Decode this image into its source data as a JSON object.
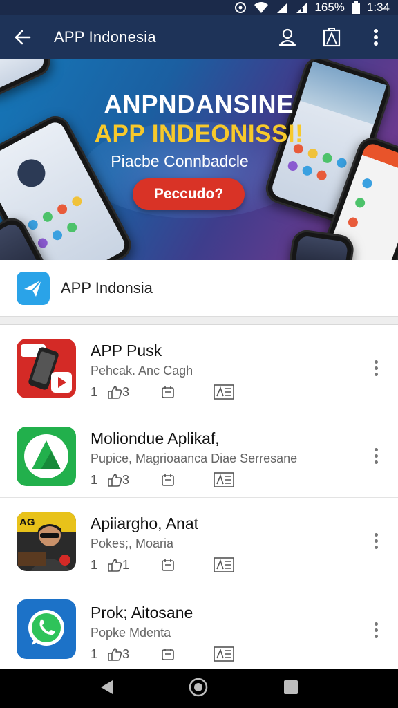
{
  "status_bar": {
    "battery": "165%",
    "time": "1:34"
  },
  "app_bar": {
    "title": "APP Indonesia"
  },
  "banner": {
    "heading_line1": "ANPNDANSINE",
    "heading_line2": "APP INDEONISSI!",
    "subheading": "Piacbe Connbadcle",
    "button_label": "Peccudo?"
  },
  "section": {
    "title": "APP Indonsia"
  },
  "apps": [
    {
      "name": "APP Pusk",
      "subtitle": "Pehcak. Anc Cagh",
      "count": "1",
      "likes": "3",
      "icon": "red-phone-icon"
    },
    {
      "name": "Moliondue Aplikaf,",
      "subtitle": "Pupice, Magrioaanca Diae Serresane",
      "count": "1",
      "likes": "3",
      "icon": "green-triangle-icon"
    },
    {
      "name": "Apiiargho, Anat",
      "subtitle": "Pokes;, Moaria",
      "count": "1",
      "likes": "1",
      "icon": "portrait-icon"
    },
    {
      "name": "Prok; Aitosane",
      "subtitle": "Popke Mdenta",
      "count": "1",
      "likes": "3",
      "icon": "whatsapp-icon"
    }
  ],
  "colors": {
    "app_bar": "#1e3358",
    "status_bar": "#1b2a4a",
    "cta": "#d93326",
    "accent_yellow": "#f7c92b"
  }
}
